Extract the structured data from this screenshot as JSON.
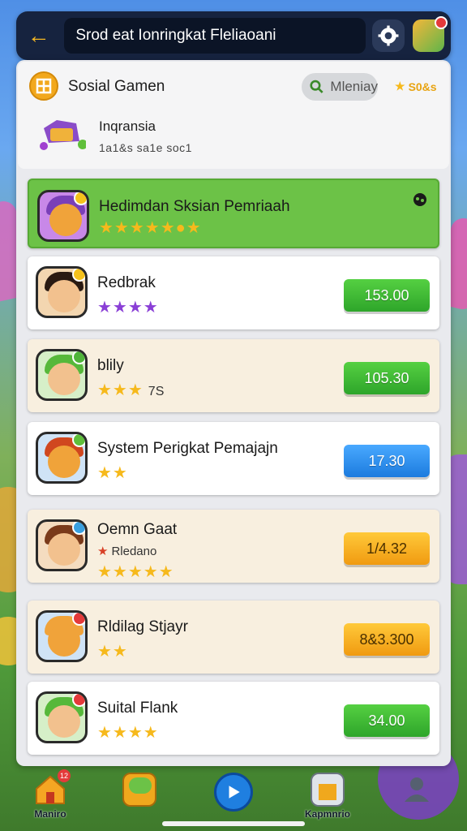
{
  "topbar": {
    "title": "Srod eat Ionringkat Fleliaoani",
    "back_icon": "back-arrow-icon",
    "settings_icon": "gear-icon",
    "accent": "#f5b823"
  },
  "header": {
    "hub_title": "Sosial Gamen",
    "menu_label": "Mleniay",
    "coins_label": "S0&s",
    "region_title": "Inqransia",
    "region_sub": "1a1&s sa1e soc1"
  },
  "rows": [
    {
      "name": "Hedimdan Sksian Pemriaah",
      "stars_text": "★★★★★●★",
      "score": "",
      "style": "highlight"
    },
    {
      "name": "Redbrak",
      "stars_text": "★★★★",
      "score": "153.00",
      "button": "green"
    },
    {
      "name": "blily",
      "stars_text": "★★★",
      "stars_extra": "7S",
      "score": "105.30",
      "button": "green"
    },
    {
      "name": "System Perigkat Pemajajn",
      "stars_text": "★★",
      "score": "17.30",
      "button": "blue"
    },
    {
      "name": "Oemn Gaat",
      "sub": "Rledano",
      "stars_text": "★★★★★",
      "score": "1/4.32",
      "button": "orange"
    },
    {
      "name": "Rldilag Stjayr",
      "stars_text": "★★",
      "score": "8&3.300",
      "button": "orange"
    },
    {
      "name": "Suital Flank",
      "stars_text": "★★★★",
      "score": "34.00",
      "button": "green"
    }
  ],
  "nav": {
    "home_label": "Maniro",
    "profile_label": "Kapmnrio",
    "home_badge": "12"
  }
}
